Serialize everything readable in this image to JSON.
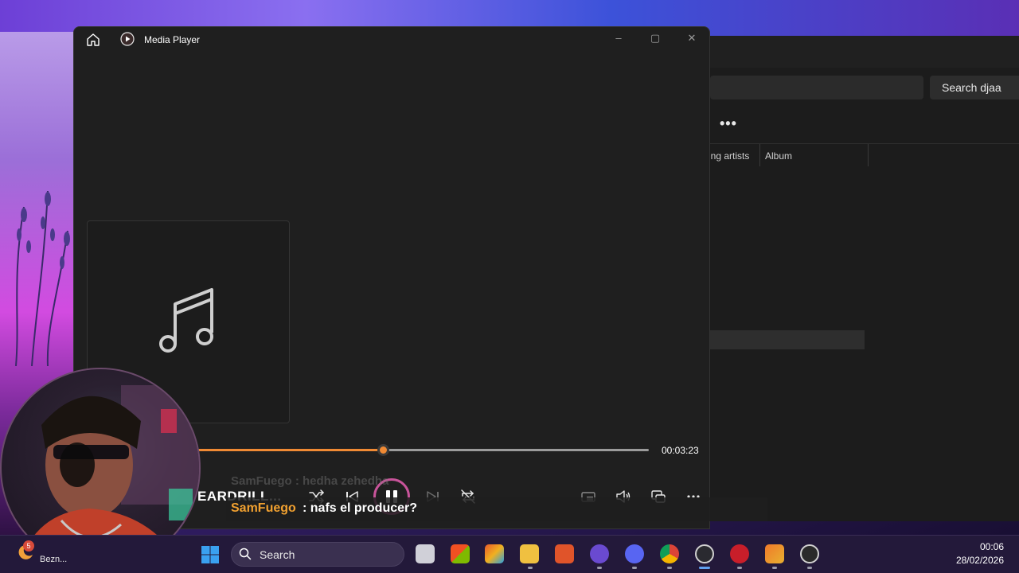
{
  "media_player": {
    "title": "Media Player",
    "track_title": "EARDRILL...",
    "total_time": "00:03:23",
    "progress": 0.41,
    "accent_color": "#f08a34",
    "icons": [
      "home-icon",
      "media-player-app-icon",
      "minimize-icon",
      "maximize-icon",
      "close-icon",
      "music-note-icon",
      "shuffle-icon",
      "previous-icon",
      "pause-icon",
      "next-icon",
      "repeat-icon",
      "mini-player-icon",
      "volume-icon",
      "cast-icon",
      "more-options-icon"
    ]
  },
  "background_app": {
    "search_button": "Search djaa",
    "more_label": "•••",
    "columns": [
      "ing artists",
      "Album"
    ]
  },
  "chat": {
    "ghost_text": "SamFuego : hedha zehedha",
    "username": "SamFuego",
    "message": ": nafs el producer?",
    "username_color": "#f0a030"
  },
  "taskbar": {
    "weather_badge": "5",
    "weather_label": "Bezn...",
    "search_label": "Search",
    "time": "00:06",
    "date": "28/02/2026",
    "apps": [
      "task-view",
      "microsoft-store",
      "office",
      "file-explorer",
      "brave",
      "app-circle",
      "discord",
      "chrome",
      "obs",
      "red-app",
      "fl-studio",
      "media-player"
    ]
  }
}
